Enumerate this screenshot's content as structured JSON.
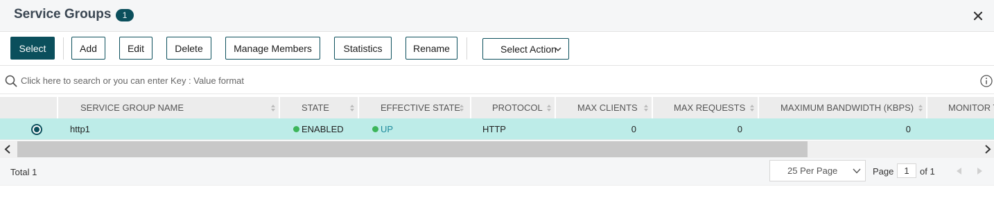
{
  "header": {
    "title": "Service Groups",
    "count": "1"
  },
  "toolbar": {
    "select": "Select",
    "add": "Add",
    "edit": "Edit",
    "delete": "Delete",
    "manage_members": "Manage Members",
    "statistics": "Statistics",
    "rename": "Rename",
    "select_action": "Select Action"
  },
  "search": {
    "placeholder": "Click here to search or you can enter Key : Value format"
  },
  "table": {
    "columns": [
      "SERVICE GROUP NAME",
      "STATE",
      "EFFECTIVE STATE",
      "PROTOCOL",
      "MAX CLIENTS",
      "MAX REQUESTS",
      "MAXIMUM BANDWIDTH (KBPS)",
      "MONITOR T"
    ],
    "rows": [
      {
        "name": "http1",
        "state": "ENABLED",
        "effective_state": "UP",
        "protocol": "HTTP",
        "max_clients": "0",
        "max_requests": "0",
        "max_bandwidth": "0"
      }
    ]
  },
  "footer": {
    "total_label": "Total",
    "total_value": "1",
    "per_page": "25 Per Page",
    "page_label": "Page",
    "page_value": "1",
    "of_label": "of 1"
  },
  "colors": {
    "accent": "#0b4f5c",
    "selected_row": "#bdece8",
    "status_green": "#3cb55a"
  }
}
